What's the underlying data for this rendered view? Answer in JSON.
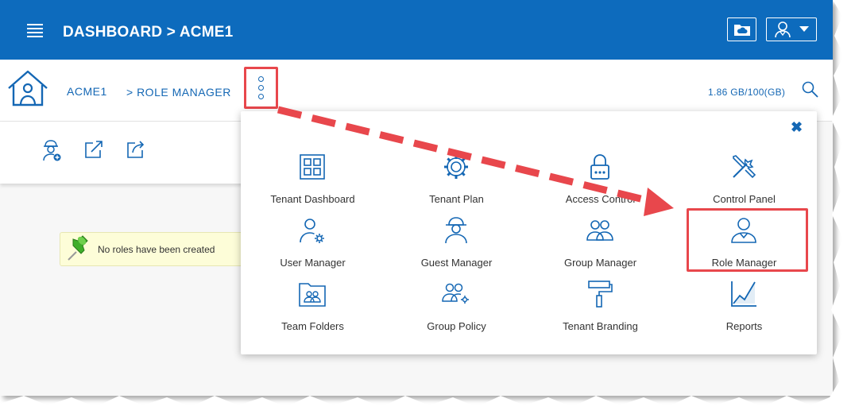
{
  "header": {
    "title": "DASHBOARD > ACME1",
    "brand_color": "#0d6bbd"
  },
  "breadcrumb": {
    "tenant": "ACME1",
    "current": "> ROLE MANAGER"
  },
  "storage": "1.86 GB/100(GB)",
  "toast": {
    "message": "No roles have been created"
  },
  "menu": {
    "items": [
      {
        "label": "Tenant Dashboard",
        "icon": "grid-icon"
      },
      {
        "label": "Tenant Plan",
        "icon": "gear-icon"
      },
      {
        "label": "Access Control",
        "icon": "lock-icon"
      },
      {
        "label": "Control Panel",
        "icon": "tools-icon"
      },
      {
        "label": "User Manager",
        "icon": "user-gear-icon"
      },
      {
        "label": "Guest Manager",
        "icon": "guest-icon"
      },
      {
        "label": "Group Manager",
        "icon": "group-icon"
      },
      {
        "label": "Role Manager",
        "icon": "role-icon"
      },
      {
        "label": "Team Folders",
        "icon": "team-folder-icon"
      },
      {
        "label": "Group Policy",
        "icon": "group-policy-icon"
      },
      {
        "label": "Tenant Branding",
        "icon": "paint-roller-icon"
      },
      {
        "label": "Reports",
        "icon": "chart-icon"
      }
    ]
  },
  "colors": {
    "accent": "#1467b4",
    "highlight": "#e8474c"
  }
}
